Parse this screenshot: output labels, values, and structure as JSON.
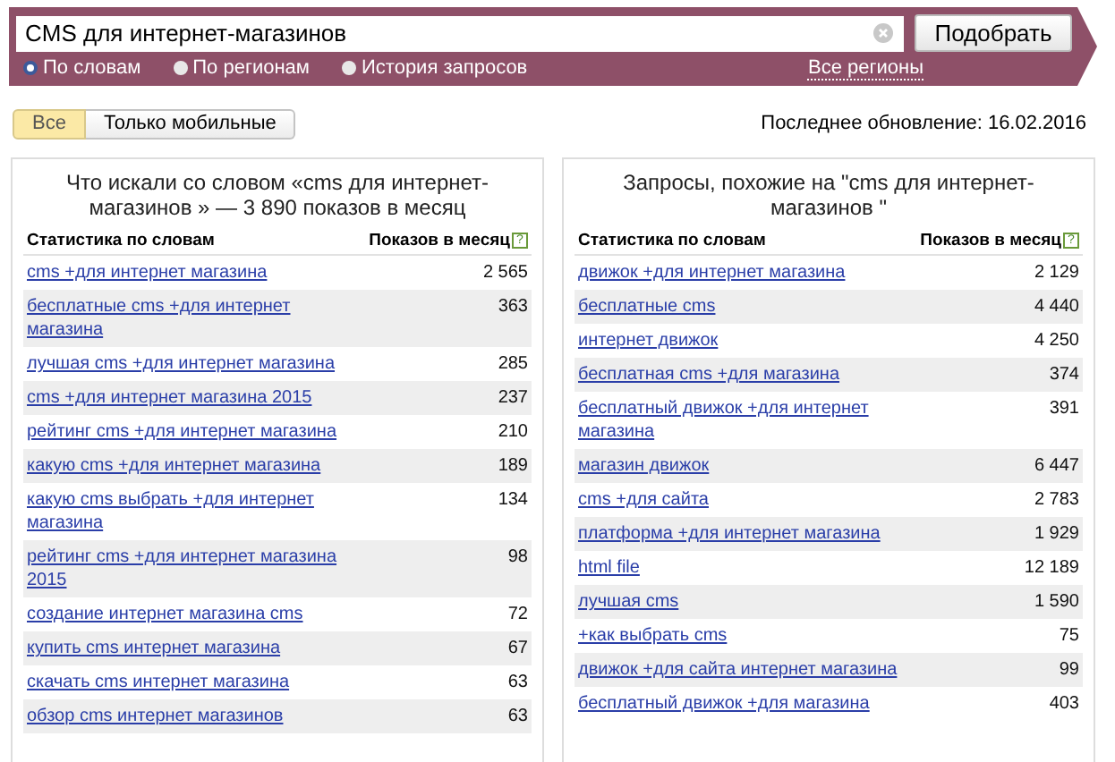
{
  "search": {
    "value": "CMS для интернет-магазинов",
    "button": "Подобрать",
    "modes": [
      {
        "label": "По словам",
        "selected": true
      },
      {
        "label": "По регионам",
        "selected": false
      },
      {
        "label": "История запросов",
        "selected": false
      }
    ],
    "regions_link": "Все регионы"
  },
  "filters": [
    {
      "label": "Все",
      "selected": true
    },
    {
      "label": "Только мобильные",
      "selected": false
    }
  ],
  "last_update": "Последнее обновление: 16.02.2016",
  "panels": [
    {
      "title": "Что искали со словом «cms для интернет-магазинов » — 3 890 показов в месяц",
      "columns": [
        "Статистика по словам",
        "Показов в месяц"
      ],
      "help": "?",
      "rows": [
        {
          "query": "cms +для интернет магазина",
          "count": "2 565"
        },
        {
          "query": "бесплатные cms +для интернет магазина",
          "count": "363"
        },
        {
          "query": "лучшая cms +для интернет магазина",
          "count": "285"
        },
        {
          "query": "cms +для интернет магазина 2015",
          "count": "237"
        },
        {
          "query": "рейтинг cms +для интернет магазина",
          "count": "210"
        },
        {
          "query": "какую cms +для интернет магазина",
          "count": "189"
        },
        {
          "query": "какую cms выбрать +для интернет магазина",
          "count": "134"
        },
        {
          "query": "рейтинг cms +для интернет магазина 2015",
          "count": "98"
        },
        {
          "query": "создание интернет магазина cms",
          "count": "72"
        },
        {
          "query": "купить cms интернет магазина",
          "count": "67"
        },
        {
          "query": "скачать cms интернет магазина",
          "count": "63"
        },
        {
          "query": "обзор cms интернет магазинов",
          "count": "63"
        }
      ]
    },
    {
      "title": "Запросы, похожие на \"cms для интернет-магазинов \"",
      "columns": [
        "Статистика по словам",
        "Показов в месяц"
      ],
      "help": "?",
      "rows": [
        {
          "query": "движок +для интернет магазина",
          "count": "2 129"
        },
        {
          "query": "бесплатные cms",
          "count": "4 440"
        },
        {
          "query": "интернет движок",
          "count": "4 250"
        },
        {
          "query": "бесплатная cms +для магазина",
          "count": "374"
        },
        {
          "query": "бесплатный движок +для интернет магазина",
          "count": "391"
        },
        {
          "query": "магазин движок",
          "count": "6 447"
        },
        {
          "query": "cms +для сайта",
          "count": "2 783"
        },
        {
          "query": "платформа +для интернет магазина",
          "count": "1 929"
        },
        {
          "query": "html file",
          "count": "12 189"
        },
        {
          "query": "лучшая cms",
          "count": "1 590"
        },
        {
          "query": "+как выбрать cms",
          "count": "75"
        },
        {
          "query": "движок +для сайта интернет магазина",
          "count": "99"
        },
        {
          "query": "бесплатный движок +для магазина",
          "count": "403"
        }
      ]
    }
  ]
}
